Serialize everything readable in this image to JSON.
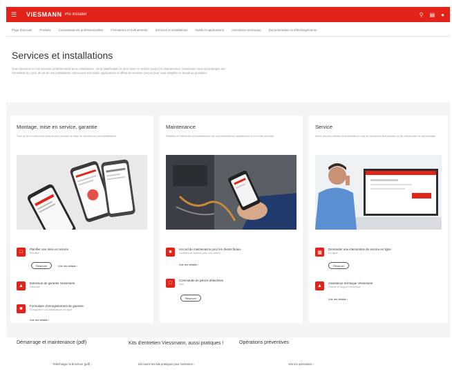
{
  "header": {
    "menu_icon": "hamburger-icon",
    "logo": "VIESMANN",
    "logo_sub": "Pro Installer",
    "icons": [
      "search-icon",
      "cart-icon",
      "user-icon"
    ],
    "brand_color": "#e2231a"
  },
  "subnav": {
    "items": [
      "Page d'accueil",
      "Produits",
      "Connaissances professionnelles",
      "Formations et événements",
      "Services et installations",
      "Outils et applications",
      "Assistance technique",
      "Documentation et téléchargements"
    ]
  },
  "page": {
    "title": "Services et installations",
    "intro": "Vous trouverez ici nos services professionnels pour installateurs : de la planification et de la mise en service jusqu'à la maintenance, Viessmann vous accompagne sur l'ensemble du cycle de vie de vos installations. Découvrez nos outils, applications et offres de services conçus pour vous simplifier le travail au quotidien."
  },
  "cards": [
    {
      "title": "Montage, mise en service, garantie",
      "desc": "Tout ce dont vous avez besoin pour réussir la mise en service de vos installations.",
      "image": "phones-app-image",
      "items": [
        {
          "icon": "app-icon",
          "title": "Planifier une mise en service",
          "sub": "Planifier"
        },
        {
          "icon": "shield-icon",
          "title": "Extension de garantie Viessmann",
          "sub": "Garantie"
        },
        {
          "icon": "document-icon",
          "title": "Formulaire d'enregistrement de garantie",
          "sub": "Enregistrez vos installations en ligne"
        }
      ],
      "pill": "Réserver",
      "link1": "Voir les détails ›",
      "link2": "Voir les détails ›"
    },
    {
      "title": "Maintenance",
      "desc": "Planifiez et effectuez la maintenance de vos installations rapidement et en toute sécurité.",
      "image": "maintenance-phone-image",
      "items": [
        {
          "icon": "tool-icon",
          "title": "Accord de maintenance pour les clients finaux",
          "sub": "Contrats de service pour vos clients"
        },
        {
          "icon": "app-icon",
          "title": "Commande de pièces détachées",
          "sub": "App"
        }
      ],
      "link1": "Voir les détails ›",
      "pill": "Réserver"
    },
    {
      "title": "Service",
      "desc": "Notre service clients vous assiste en cas de questions techniques ou de demandes de dépannage.",
      "image": "service-desk-image",
      "items": [
        {
          "icon": "grid-icon",
          "title": "Demander une intervention de service en ligne",
          "sub": "En ligne"
        },
        {
          "icon": "shield-icon",
          "title": "Assistance technique Viessmann",
          "sub": "Hotline et support technique"
        }
      ],
      "pill": "Réserver",
      "link1": "Voir les détails ›"
    }
  ],
  "bottom": [
    {
      "title": "Démarrage et maintenance (pdf)",
      "sub": "Télécharger la brochure (pdf) ›"
    },
    {
      "title": "Kits d'entretien Viessmann, aussi pratiques !",
      "sub": "Découvrir les kits pratiques pour l'entretien ›"
    },
    {
      "title": "Opérations préventives",
      "sub": "Voir les opérations ›"
    }
  ]
}
